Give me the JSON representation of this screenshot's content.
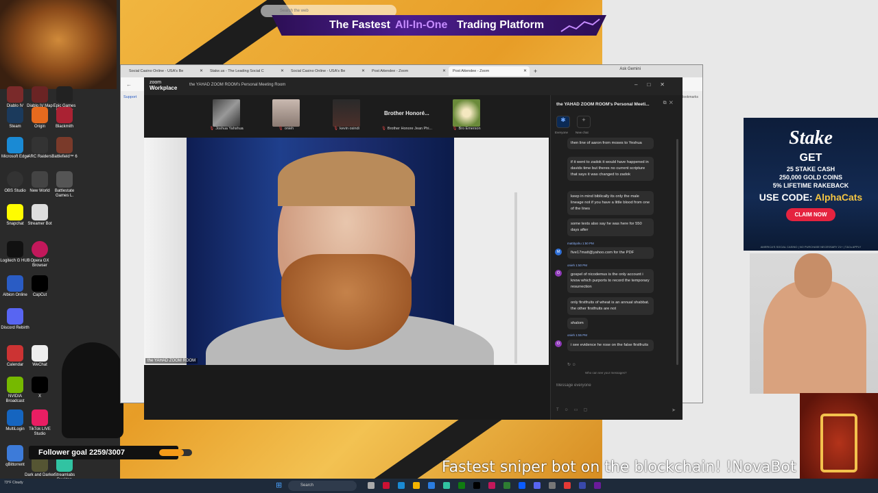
{
  "top_search": {
    "placeholder": "Search the web"
  },
  "banner": {
    "part1": "The Fastest",
    "accent": "All-In-One",
    "part2": "Trading Platform"
  },
  "desktop_icons": [
    {
      "label": "Diablo IV"
    },
    {
      "label": "Diablo IV Map"
    },
    {
      "label": "Epic Games Launcher"
    },
    {
      "label": "Steam"
    },
    {
      "label": "Origin"
    },
    {
      "label": "Blackmith"
    },
    {
      "label": "Microsoft Edge"
    },
    {
      "label": "ARC Raiders"
    },
    {
      "label": "Battlefield™ 6"
    },
    {
      "label": "OBS Studio"
    },
    {
      "label": "New World"
    },
    {
      "label": "Battlestate Games L."
    },
    {
      "label": "Snapchat"
    },
    {
      "label": "Streamer Bot"
    },
    {
      "label": "Logitech G HUB"
    },
    {
      "label": "Opera GX Browser"
    },
    {
      "label": "Albion Online"
    },
    {
      "label": "CapCut"
    },
    {
      "label": "Discord Rebirth"
    },
    {
      "label": "Calendar"
    },
    {
      "label": "WeChat"
    },
    {
      "label": "NVIDIA Broadcast"
    },
    {
      "label": "X"
    },
    {
      "label": "MultiLogin"
    },
    {
      "label": "TikTok LIVE Studio"
    },
    {
      "label": "qBittorrent"
    },
    {
      "label": "Dark and Darker"
    },
    {
      "label": "Streamlabs Desktop"
    }
  ],
  "browser": {
    "tabs": [
      {
        "label": "Social Casino Online - USA's Be"
      },
      {
        "label": "Stake.us - The Leading Social C"
      },
      {
        "label": "Social Casino Online - USA's Be"
      },
      {
        "label": "Post Attendee - Zoom"
      },
      {
        "label": "Post Attendee - Zoom"
      }
    ],
    "ask": "Ask Gemini",
    "support": "Support",
    "bookmarks": "Bookmarks"
  },
  "zoom": {
    "brand_small": "zoom",
    "brand": "Workplace",
    "meeting_title": "the YAHAD ZOOM ROOM's Personal Meeting Room",
    "participants": [
      {
        "name": "Joshua Yahshua"
      },
      {
        "name": "onieh"
      },
      {
        "name": "kevin osindi"
      },
      {
        "name": "Brother Honore Jean Phi..."
      },
      {
        "name": "Bro Emerson"
      }
    ],
    "big_name": "Brother Honoré...",
    "video_label": "the YAHAD ZOOM ROOM",
    "chat": {
      "title": "the YAHAD ZOOM ROOM's Personal Meeti...",
      "tab_everyone": "Everyone",
      "tab_new": "New chat",
      "messages": [
        {
          "text": "then line of aaron from moses to Yeshua"
        },
        {
          "text": "if it went to zadok it would have happened in davids time but theres no current scripture that says it was changed to zadok"
        },
        {
          "text": "keep in mind biblically its only the male lineage not if you have a little blood from one of the lines"
        },
        {
          "text": "some texts also say he was here for 550 days after"
        },
        {
          "sender": "mattityahu 1:50 PM",
          "text": "five17matt@yahoo.com for the PDF"
        },
        {
          "sender": "onieh 1:50 PM",
          "text": "gospel of nicodemus is the only account i know which purports to record the temporary resurrection"
        },
        {
          "text": "only firstfruits of wheat is an annual shabbat. the other firstfruits are not"
        },
        {
          "text": "shalom"
        },
        {
          "sender": "onieh 1:55 PM",
          "text": "i see evidence he rose on the false firstfruits"
        }
      ],
      "who_can_see": "Who can see your messages?",
      "compose_placeholder": "Message everyone"
    }
  },
  "stake_ad": {
    "logo": "Stake",
    "get": "GET",
    "line1": "25 STAKE CASH",
    "line2": "250,000 GOLD COINS",
    "line3": "5% LIFETIME RAKEBACK",
    "code_label": "USE CODE:",
    "code": "AlphaCats",
    "button": "CLAIM NOW",
    "fine": "AMERICA'S SOCIAL CASINO | NO PURCHASE NECESSARY 21+ | T&Cs APPLY"
  },
  "follower_goal": {
    "label": "Follower goal 2259/3007",
    "current": 2259,
    "target": 3007
  },
  "ticker": "Fastest sniper bot on the blockchain! !NovaBot",
  "taskbar": {
    "weather": "73°F Cloudy",
    "search": "Search"
  },
  "colors": {
    "zoom_bg": "#1a1a1a",
    "chat_bubble": "#2e2e2e",
    "accent_blue": "#0b5cff",
    "banner_purple": "#4b1d8c",
    "progress_orange": "#f59a18"
  }
}
